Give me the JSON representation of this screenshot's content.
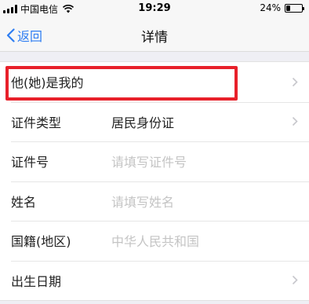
{
  "status_bar": {
    "carrier": "中国电信",
    "time": "19:29",
    "battery_percent": "24%",
    "battery_level": 0.24
  },
  "nav": {
    "back_label": "返回",
    "title": "详情"
  },
  "rows": [
    {
      "label": "他(她)是我的",
      "value": "",
      "placeholder": false,
      "chevron": true
    },
    {
      "label": "证件类型",
      "value": "居民身份证",
      "placeholder": false,
      "chevron": true
    },
    {
      "label": "证件号",
      "value": "请填写证件号",
      "placeholder": true,
      "chevron": false
    },
    {
      "label": "姓名",
      "value": "请填写姓名",
      "placeholder": true,
      "chevron": false
    },
    {
      "label": "国籍(地区)",
      "value": "中华人民共和国",
      "placeholder": true,
      "chevron": false
    },
    {
      "label": "出生日期",
      "value": "",
      "placeholder": false,
      "chevron": true
    }
  ],
  "colors": {
    "accent": "#2f7ef2",
    "highlight": "#e8202a",
    "placeholder": "#c4c4c4"
  }
}
